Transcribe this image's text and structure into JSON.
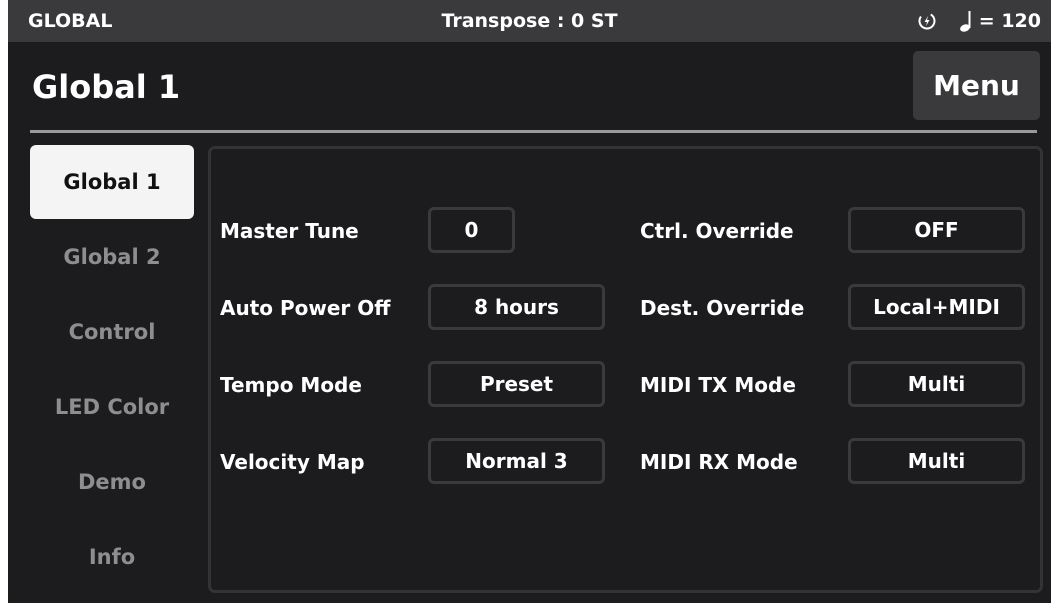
{
  "status_bar": {
    "mode": "GLOBAL",
    "transpose": "Transpose : 0 ST",
    "tempo": "= 120"
  },
  "header": {
    "title": "Global 1",
    "menu_label": "Menu"
  },
  "tabs": [
    {
      "label": "Global 1",
      "active": true
    },
    {
      "label": "Global 2",
      "active": false
    },
    {
      "label": "Control",
      "active": false
    },
    {
      "label": "LED Color",
      "active": false
    },
    {
      "label": "Demo",
      "active": false
    },
    {
      "label": "Info",
      "active": false
    }
  ],
  "params_left": [
    {
      "label": "Master Tune",
      "value": "0"
    },
    {
      "label": "Auto Power Off",
      "value": "8 hours"
    },
    {
      "label": "Tempo Mode",
      "value": "Preset"
    },
    {
      "label": "Velocity Map",
      "value": "Normal 3"
    }
  ],
  "params_right": [
    {
      "label": "Ctrl. Override",
      "value": "OFF"
    },
    {
      "label": "Dest. Override",
      "value": "Local+MIDI"
    },
    {
      "label": "MIDI TX Mode",
      "value": "Multi"
    },
    {
      "label": "MIDI RX Mode",
      "value": "Multi"
    }
  ],
  "colors": {
    "background": "#1c1c1f",
    "status_bar": "#3a3a3c",
    "active_tab": "#f4f4f4",
    "inactive_tab_text": "#8e8e90"
  }
}
